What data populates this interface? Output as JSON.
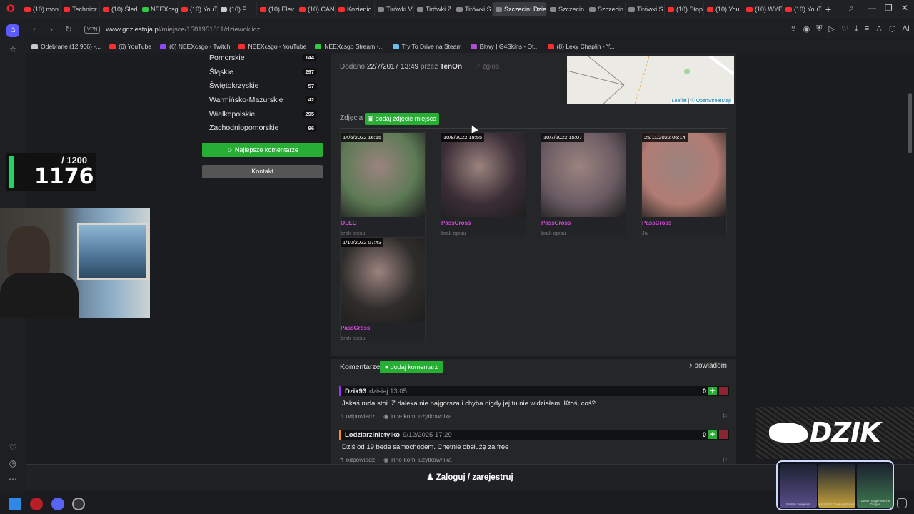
{
  "browser": {
    "tabs": [
      {
        "label": "(10) mon",
        "color": "#ff2d2d"
      },
      {
        "label": "Technicz",
        "color": "#ff2d2d"
      },
      {
        "label": "(10) Śled",
        "color": "#ff2d2d"
      },
      {
        "label": "NEEXcsg",
        "color": "#2ecc40"
      },
      {
        "label": "(10) YouT",
        "color": "#ff2d2d"
      },
      {
        "label": "(10) F",
        "color": "#cccccc"
      },
      {
        "label": "(10) Elev",
        "color": "#ff2d2d"
      },
      {
        "label": "(10) CAN",
        "color": "#ff2d2d"
      },
      {
        "label": "Kozienic",
        "color": "#ff2d2d"
      },
      {
        "label": "Tirówki V",
        "color": "#888888"
      },
      {
        "label": "Tirówki Z",
        "color": "#888888"
      },
      {
        "label": "Tirówki S",
        "color": "#888888"
      },
      {
        "label": "Szczecin: Dziew",
        "color": "#888888",
        "active": true
      },
      {
        "label": "Szczecin",
        "color": "#888888"
      },
      {
        "label": "Szczecin",
        "color": "#888888"
      },
      {
        "label": "Tirówki S",
        "color": "#888888"
      },
      {
        "label": "(10) Stop",
        "color": "#ff2d2d"
      },
      {
        "label": "(10) You",
        "color": "#ff2d2d"
      },
      {
        "label": "(10) WYE",
        "color": "#ff2d2d"
      },
      {
        "label": "(10) YouT",
        "color": "#ff2d2d"
      }
    ],
    "new_tab": "+",
    "vpn_label": "VPN",
    "url_host": "www.gdziestoja.pl",
    "url_path": "/miejsce/1581951811/dziewoklicz",
    "ai_label": "AI",
    "bookmarks": [
      {
        "label": "Odebrane (12 966) -...",
        "color": "#c8c8c8"
      },
      {
        "label": "(6) YouTube",
        "color": "#ff2d2d"
      },
      {
        "label": "(6) NEEXcsgo - Twitch",
        "color": "#9146ff"
      },
      {
        "label": "NEEXcsgo - YouTube",
        "color": "#ff2d2d"
      },
      {
        "label": "NEEXcsgo Stream -...",
        "color": "#2ecc40"
      },
      {
        "label": "Try To Drive na Steam",
        "color": "#66c0f4"
      },
      {
        "label": "Bitwy | G4Skins - Ot...",
        "color": "#b04cd9"
      },
      {
        "label": "(8) Lexy Chaplin - Y...",
        "color": "#ff2d2d"
      }
    ]
  },
  "regions": [
    {
      "name": "Pomorskie",
      "count": "144"
    },
    {
      "name": "Śląskie",
      "count": "297"
    },
    {
      "name": "Świętokrzyskie",
      "count": "57"
    },
    {
      "name": "Warmińsko-Mazurskie",
      "count": "42"
    },
    {
      "name": "Wielkopolskie",
      "count": "295"
    },
    {
      "name": "Zachodniopomorskie",
      "count": "96"
    }
  ],
  "left_buttons": {
    "best_comments": "Najlepsze komentarze",
    "contact": "Kontakt"
  },
  "place": {
    "added_label": "Dodano",
    "added_date": "22/7/2017 13:49",
    "added_by_label": "przez",
    "added_by": "TenOn",
    "report": "zgłoś",
    "map_attr_leaflet": "Leaflet",
    "map_attr_osm": "© OpenStreetMap"
  },
  "photos": {
    "label": "Zdjęcia",
    "add_button": "dodaj zdjęcie miejsca",
    "items": [
      {
        "date": "14/6/2022 16:15",
        "author": "OLEG",
        "desc": "brak opisu",
        "tone": "#5d7a55"
      },
      {
        "date": "10/8/2022 18:55",
        "author": "PassCross",
        "desc": "brak opisu",
        "tone": "#3b2e36"
      },
      {
        "date": "10/7/2022 15:07",
        "author": "PassCross",
        "desc": "brak opisu",
        "tone": "#6b5c63"
      },
      {
        "date": "25/11/2022 06:14",
        "author": "PassCross",
        "desc": "Ja",
        "tone": "#b17c73"
      },
      {
        "date": "1/10/2022 07:43",
        "author": "PassCross",
        "desc": "brak opisu",
        "tone": "#2f2d2b"
      }
    ]
  },
  "comments": {
    "title": "Komentarze",
    "add_button": "dodaj komentarz",
    "notify": "powiadom",
    "items": [
      {
        "author": "Dzik93",
        "time": "dzisiaj 13:05",
        "score": "0",
        "text": "Jakaś ruda stoi. Z daleka nie najgorsza i chyba nigdy jej tu nie widziałem. Ktoś, coś?",
        "reply": "odpowiedz",
        "other": "inne kom. użytkownika",
        "bar": "#9b30ff"
      },
      {
        "author": "Lodziarzinietylko",
        "time": "9/12/2025 17:29",
        "score": "0",
        "text": "Dziś od 19 bede samochodem. Chętnie obsłużę za free",
        "reply": "odpowiedz",
        "other": "inne kom. użytkownika",
        "bar": "#ff8c1a"
      }
    ]
  },
  "login_bar": "Zaloguj / zarejestruj",
  "overlay": {
    "counter_max": "/ 1200",
    "counter_value": "1176",
    "brand": "DZIK",
    "cases": [
      {
        "label": "Famas Sergeant",
        "color": "#5a4e8c"
      },
      {
        "label": "Karambit Case Hardened",
        "color": "#c8a43a"
      },
      {
        "label": "Desert Eagle Mecha Dragon",
        "color": "#3e7a4e"
      }
    ]
  }
}
